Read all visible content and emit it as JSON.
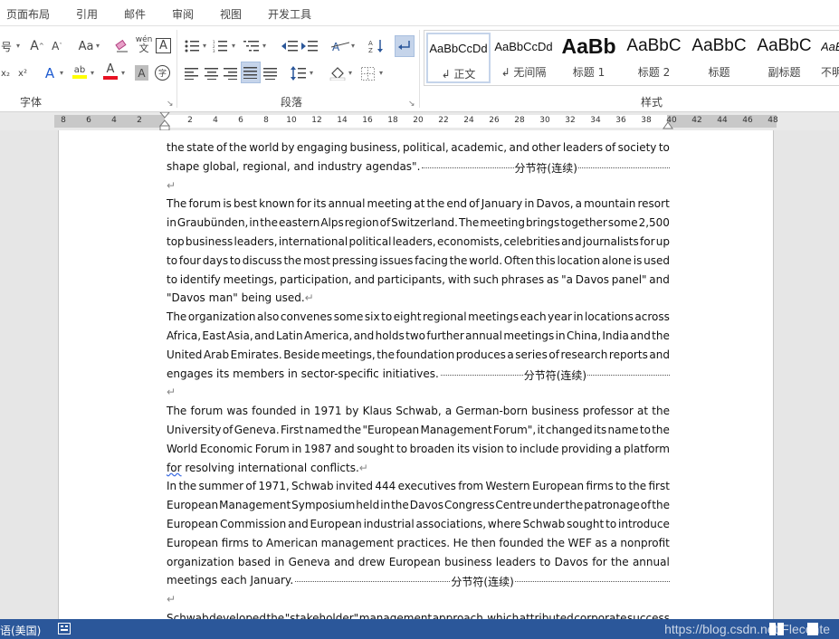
{
  "tabs": [
    "页面布局",
    "引用",
    "邮件",
    "审阅",
    "视图",
    "开发工具"
  ],
  "ribbon": {
    "font_size_partial": "号",
    "groups": {
      "font": "字体",
      "paragraph": "段落",
      "styles": "样式"
    },
    "font_buttons": {
      "grow": "A",
      "shrink": "A",
      "case": "Aa",
      "phonetic": "wén",
      "border_char": "A",
      "subscript": "x₂",
      "superscript": "x²",
      "highlight": "ab",
      "font_color": "A",
      "shading_char": "A",
      "enclose": "字"
    },
    "colors": {
      "highlight": "#ffff00",
      "font_color": "#e81123",
      "accent": "#2b579a",
      "selected_button": "#c5d4ea"
    }
  },
  "styles_gallery": [
    {
      "sample": "AaBbCcDd",
      "name": "↲ 正文",
      "selected": true
    },
    {
      "sample": "AaBbCcDd",
      "name": "↲ 无间隔",
      "selected": false
    },
    {
      "sample": "AaBb",
      "name": "标题 1",
      "selected": false
    },
    {
      "sample": "AaBbC",
      "name": "标题 2",
      "selected": false
    },
    {
      "sample": "AaBbC",
      "name": "标题",
      "selected": false
    },
    {
      "sample": "AaBbC",
      "name": "副标题",
      "selected": false
    },
    {
      "sample": "AaBb",
      "name": "不明",
      "selected": false
    }
  ],
  "ruler": {
    "left_numbers": [
      "8",
      "6",
      "4",
      "2"
    ],
    "right_numbers": [
      "2",
      "4",
      "6",
      "8",
      "10",
      "12",
      "14",
      "16",
      "18",
      "20",
      "22",
      "24",
      "26",
      "28",
      "30",
      "32",
      "34",
      "36",
      "38",
      "40",
      "42",
      "44",
      "46",
      "48"
    ]
  },
  "document": {
    "section_break_label": "分节符(连续)",
    "lines": [
      {
        "text": "the state of the world by engaging business, political, academic, and other leaders of society to",
        "justify": true
      },
      {
        "text": "shape global, regional, and industry agendas\".",
        "justify": false,
        "section_break": true
      },
      {
        "text": "",
        "empty": true
      },
      {
        "text": "The forum is best known for its annual meeting at the end of January in Davos, a mountain resort",
        "justify": true
      },
      {
        "text": "in Graubünden, in the eastern Alps region of Switzerland. The meeting brings together some 2,500",
        "justify": true
      },
      {
        "text": "top business leaders, international political leaders, economists, celebrities and journalists for up",
        "justify": true
      },
      {
        "text": "to four days to discuss the most pressing issues facing the world. Often this location alone is used",
        "justify": true
      },
      {
        "text": "to identify meetings, participation, and participants, with such phrases as \"a Davos panel\" and",
        "justify": true
      },
      {
        "text": "\"Davos man\" being used.",
        "justify": false,
        "para_end": true
      },
      {
        "text": "The organization also convenes some six to eight regional meetings each year in locations across",
        "justify": true
      },
      {
        "text": "Africa, East Asia, and Latin America, and holds two further annual meetings in China, India and the",
        "justify": true
      },
      {
        "text": "United Arab Emirates. Beside meetings, the foundation produces a series of research reports and",
        "justify": true
      },
      {
        "text": "engages its members in sector-specific initiatives.",
        "justify": false,
        "section_break": true
      },
      {
        "text": "",
        "empty": true
      },
      {
        "text": "The forum was founded in 1971 by Klaus Schwab, a German-born business professor at the",
        "justify": true
      },
      {
        "text": "University of Geneva. First named the \"European Management Forum\", it changed its name to the",
        "justify": true
      },
      {
        "text": "World Economic Forum in 1987 and sought to broaden its vision to include providing a platform",
        "justify": true
      },
      {
        "text": "for resolving international conflicts.",
        "justify": false,
        "para_end": true,
        "squiggle_first": true
      },
      {
        "text": "In the summer of 1971, Schwab invited 444 executives from Western European firms to the first",
        "justify": true
      },
      {
        "text": "European Management Symposium held in the Davos Congress Centre under the patronage of the",
        "justify": true
      },
      {
        "text": "European Commission and European industrial associations, where Schwab sought to introduce",
        "justify": true
      },
      {
        "text": "European firms to American management practices. He then founded the WEF as a nonprofit",
        "justify": true
      },
      {
        "text": "organization based in Geneva and drew European business leaders to Davos for the annual",
        "justify": true
      },
      {
        "text": "meetings each January.",
        "justify": false,
        "section_break": true
      },
      {
        "text": "",
        "empty": true
      },
      {
        "text": "Schwab developed the \"stakeholder\" management approach, which attributed corporate success",
        "justify": true
      }
    ]
  },
  "status": {
    "language": "语(美国)",
    "watermark": "https://blog.csdn.net/Flecente"
  }
}
